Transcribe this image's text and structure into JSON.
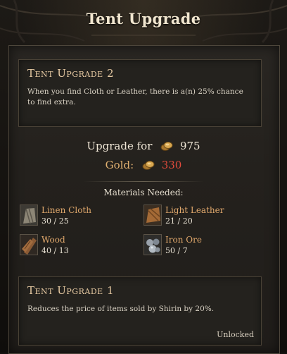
{
  "window": {
    "title": "Tent Upgrade"
  },
  "current_upgrade": {
    "title": "Tent Upgrade 2",
    "description": "When you find Cloth or Leather, there is a(n) 25% chance to find extra."
  },
  "cost": {
    "upgrade_label": "Upgrade for",
    "upgrade_price": "975",
    "gold_label": "Gold:",
    "gold_value": "330",
    "gold_value_color": "#e04a3c"
  },
  "materials": {
    "title": "Materials Needed:",
    "items": [
      {
        "name": "Linen Cloth",
        "count": "30 / 25",
        "icon": "linen-cloth-icon"
      },
      {
        "name": "Light Leather",
        "count": "21 / 20",
        "icon": "light-leather-icon"
      },
      {
        "name": "Wood",
        "count": "40 / 13",
        "icon": "wood-icon"
      },
      {
        "name": "Iron Ore",
        "count": "50 / 7",
        "icon": "iron-ore-icon"
      }
    ]
  },
  "previous_upgrade": {
    "title": "Tent Upgrade 1",
    "description": "Reduces the price of items sold by Shirin by 20%.",
    "status": "Unlocked"
  },
  "colors": {
    "accent_title": "#e6c9a2",
    "material_name": "#e0a86c",
    "panel_bg": "#24211d"
  }
}
